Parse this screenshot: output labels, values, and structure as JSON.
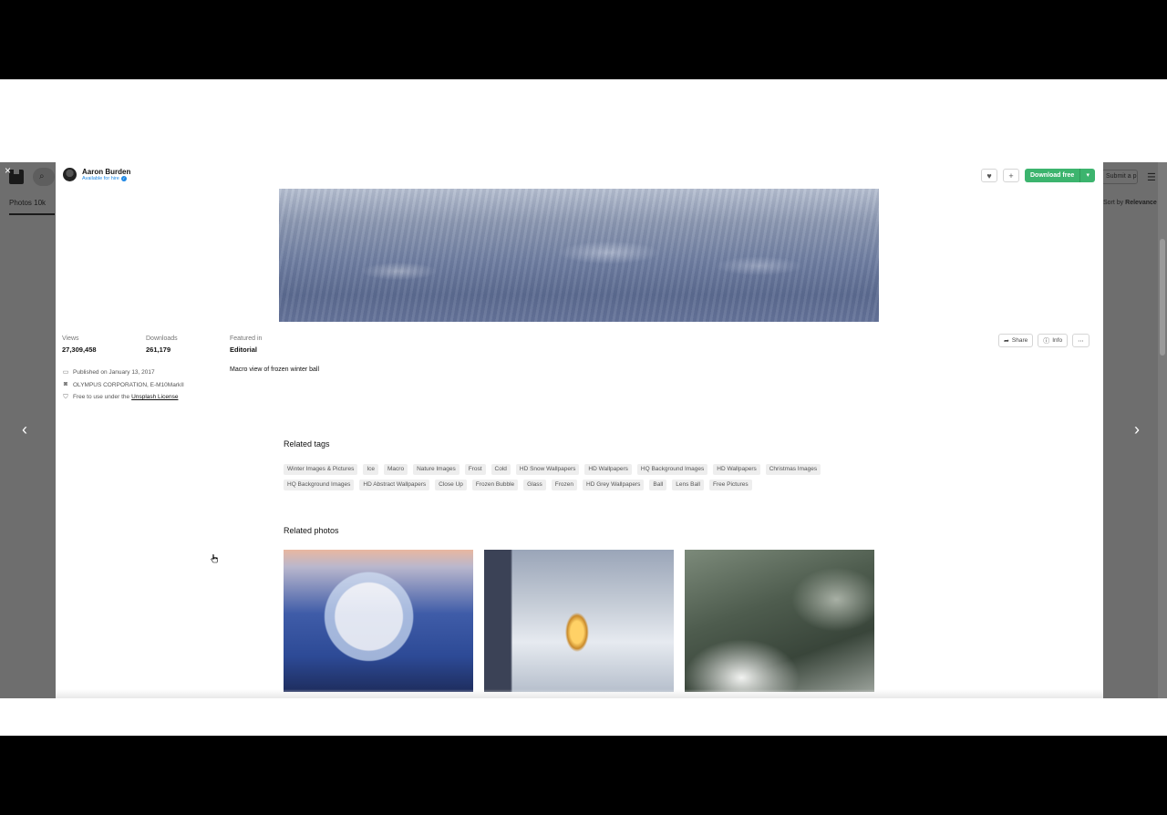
{
  "backdrop": {
    "tab_label": "Photos 10k",
    "submit_label": "Submit a photo",
    "sort_prefix": "Sort by",
    "sort_value": "Relevance",
    "menu_icon": "hamburger-icon",
    "close_glyph": "×",
    "prev_glyph": "‹",
    "next_glyph": "›"
  },
  "author": {
    "name": "Aaron Burden",
    "subtitle": "Available for hire"
  },
  "actions": {
    "download_label": "Download free",
    "share_label": "Share",
    "info_label": "Info"
  },
  "stats": {
    "views_label": "Views",
    "views_value": "27,309,458",
    "downloads_label": "Downloads",
    "downloads_value": "261,179",
    "featured_label": "Featured in",
    "featured_value": "Editorial"
  },
  "meta": {
    "published": "Published on January 13, 2017",
    "camera": "OLYMPUS CORPORATION, E-M10MarkII",
    "license_prefix": "Free to use under the",
    "license_link": "Unsplash License"
  },
  "description": "Macro view of frozen winter ball",
  "related_tags_title": "Related tags",
  "tags": [
    "Winter Images & Pictures",
    "Ice",
    "Macro",
    "Nature Images",
    "Frost",
    "Cold",
    "HD Snow Wallpapers",
    "HD Wallpapers",
    "HQ Background Images",
    "HD Wallpapers",
    "Christmas Images",
    "HQ Background Images",
    "HD Abstract Wallpapers",
    "Close Up",
    "Frozen Bubble",
    "Glass",
    "Frozen",
    "HD Grey Wallpapers",
    "Ball",
    "Lens Ball",
    "Free Pictures"
  ],
  "related_photos_title": "Related photos",
  "colors": {
    "download_green": "#3cb46e",
    "verified_blue": "#1e88e5",
    "backdrop_gray": "#6e6e6e"
  }
}
